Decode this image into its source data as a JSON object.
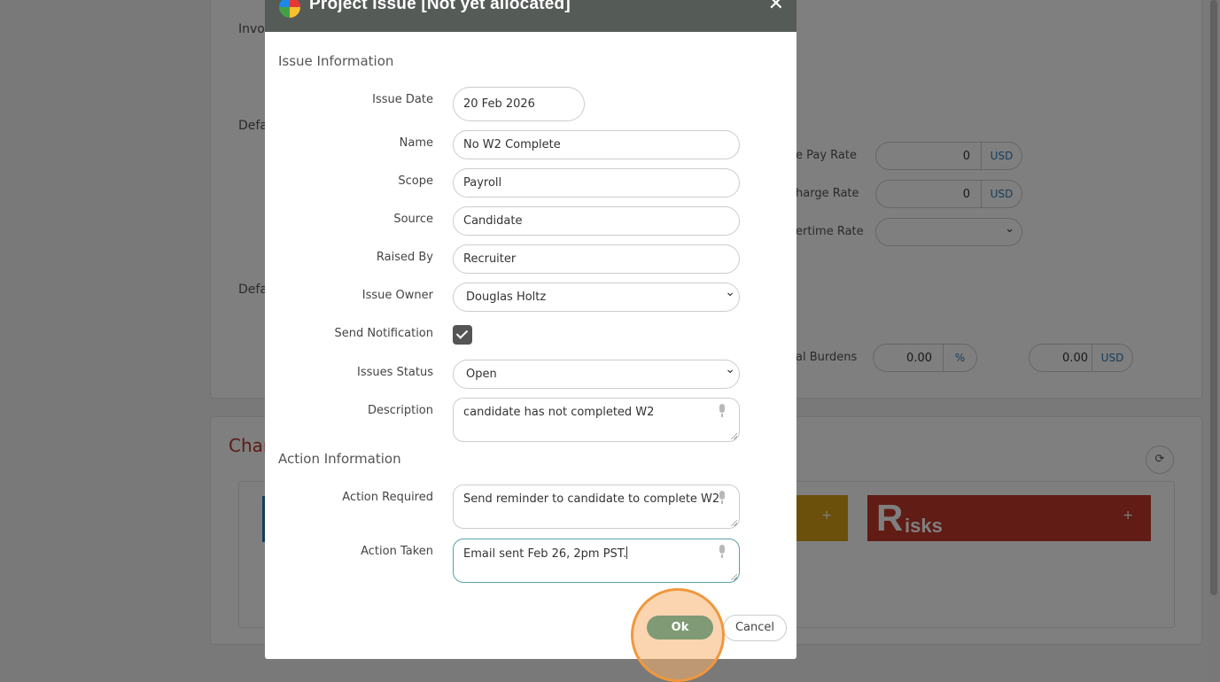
{
  "background": {
    "labels": {
      "invoice": "Invo",
      "defaults_1": "Defa",
      "defaults_2": "Defa",
      "pay_rate": "e Pay Rate",
      "charge_rate": "harge Rate",
      "overtime_rate": "ertime Rate",
      "burdens": "al Burdens",
      "charts_title": "Char"
    },
    "pay_rate": {
      "value": "0",
      "unit": "USD"
    },
    "charge_rate": {
      "value": "0",
      "unit": "USD"
    },
    "burden_percent": {
      "value": "0.00",
      "unit": "%"
    },
    "burden_amount": {
      "value": "0.00",
      "unit": "USD"
    },
    "risks_tile": {
      "initial": "R",
      "label": "isks",
      "add": "+"
    },
    "yellow_tile": {
      "add": "+"
    }
  },
  "modal": {
    "title": "Project Issue [Not yet allocated]",
    "close": "✕",
    "issue_section": "Issue Information",
    "action_section": "Action Information",
    "fields": {
      "issue_date": {
        "label": "Issue Date",
        "value": "20 Feb 2026"
      },
      "name": {
        "label": "Name",
        "value": "No W2 Complete"
      },
      "scope": {
        "label": "Scope",
        "value": "Payroll"
      },
      "source": {
        "label": "Source",
        "value": "Candidate"
      },
      "raised_by": {
        "label": "Raised By",
        "value": "Recruiter"
      },
      "issue_owner": {
        "label": "Issue Owner",
        "value": "Douglas Holtz"
      },
      "send_notification": {
        "label": "Send Notification",
        "checked": true
      },
      "issues_status": {
        "label": "Issues Status",
        "value": "Open"
      },
      "description": {
        "label": "Description",
        "value": "candidate has not completed W2"
      },
      "action_required": {
        "label": "Action Required",
        "value": "Send reminder to candidate to complete W2"
      },
      "action_taken": {
        "label": "Action Taken",
        "value": "Email sent Feb 26, 2pm PST."
      }
    },
    "buttons": {
      "ok": "Ok",
      "cancel": "Cancel"
    }
  },
  "colors": {
    "header": "#555b57",
    "ok_button": "#7f9a74",
    "highlight": "#f0973e",
    "risks": "#c0392b",
    "yellow_tile": "#d4a017",
    "blue_tile": "#2a7ab8"
  }
}
